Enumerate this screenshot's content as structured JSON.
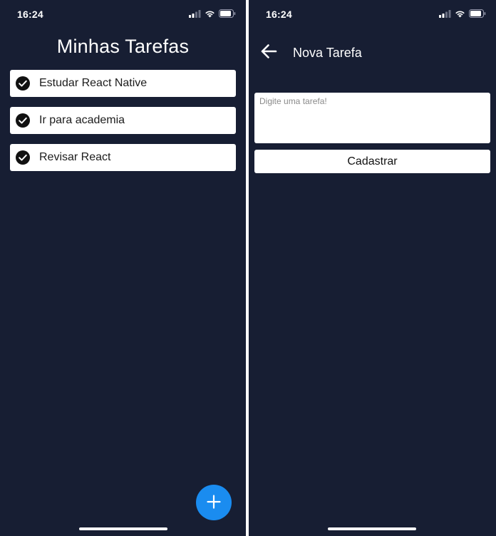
{
  "colors": {
    "background": "#171e33",
    "card": "#ffffff",
    "fab": "#1a8cf0",
    "text_light": "#ffffff",
    "text_dark": "#1c1c1c"
  },
  "list_screen": {
    "status": {
      "time": "16:24",
      "icons": [
        "cellular-signal-icon",
        "wifi-icon",
        "battery-icon"
      ]
    },
    "title": "Minhas Tarefas",
    "tasks": [
      {
        "label": "Estudar React Native",
        "icon": "check-circle-icon"
      },
      {
        "label": "Ir para academia",
        "icon": "check-circle-icon"
      },
      {
        "label": "Revisar React",
        "icon": "check-circle-icon"
      }
    ],
    "fab_icon": "plus-icon"
  },
  "new_task_screen": {
    "status": {
      "time": "16:24",
      "icons": [
        "cellular-signal-icon",
        "wifi-icon",
        "battery-icon"
      ]
    },
    "back_icon": "arrow-left-icon",
    "title": "Nova Tarefa",
    "input": {
      "placeholder": "Digite uma tarefa!",
      "value": ""
    },
    "submit_label": "Cadastrar"
  }
}
